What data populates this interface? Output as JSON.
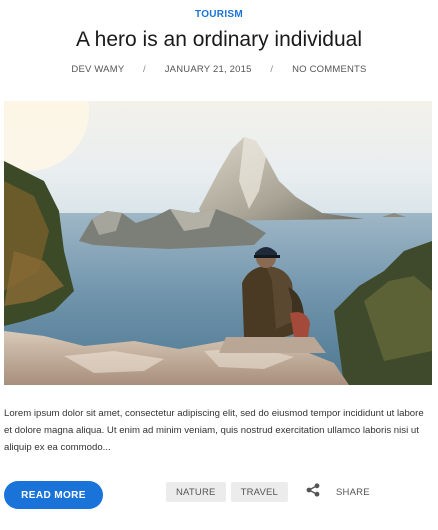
{
  "post": {
    "category": "TOURISM",
    "title": "A hero is an ordinary individual",
    "meta": {
      "author": "DEV WAMY",
      "separator": "/",
      "date": "JANUARY 21, 2015",
      "comments": "NO COMMENTS"
    },
    "image": {
      "icon": "hero-photo-man-sitting-on-cliff-overlooking-sea"
    },
    "excerpt": "Lorem ipsum dolor sit amet, consectetur adipiscing elit, sed do eiusmod tempor incididunt ut labore et dolore magna aliqua. Ut enim ad minim veniam, quis nostrud exercitation ullamco laboris nisi ut aliquip ex ea commodo...",
    "read_more_label": "READ MORE",
    "tags": [
      "NATURE",
      "TRAVEL"
    ],
    "share_label": "SHARE"
  },
  "colors": {
    "accent": "#1a73d9",
    "tag_bg": "#ececec",
    "text": "#333333"
  }
}
